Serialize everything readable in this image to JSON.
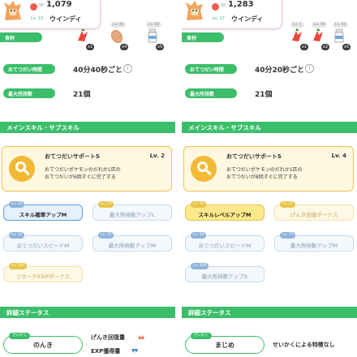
{
  "panels": [
    {
      "sp_label": "SP",
      "sp_value": "1,079",
      "level": "Lv. 13",
      "pokemon_name": "ウインディ",
      "ingredients_label": "食材",
      "ingredients": [
        {
          "level": "Lv. 1",
          "count": "x1"
        },
        {
          "level": "Lv. 30",
          "count": "x4"
        },
        {
          "level": "Lv. 60",
          "count": "x5"
        }
      ],
      "help_time_label": "おてつだい時間",
      "help_time_value": "40分40秒ごと",
      "max_carry_label": "最大所持数",
      "max_carry_value": "21個",
      "section_skills": "メインスキル・サブスキル",
      "main_skill": {
        "name": "おてつだいサポートS",
        "level": "Lv. 2",
        "description_line1": "おてつだいポケモンのだれか1匹の",
        "description_line2": "おてつだいが6回すぐに完了する"
      },
      "sub_skills": [
        {
          "level": "Lv. 10",
          "label": "スキル確率アップM"
        },
        {
          "level": "Lv. 25",
          "label": "最大所持数アップL"
        },
        {
          "level": "Lv. 50",
          "label": "おてつだいスピードM"
        },
        {
          "level": "Lv. 75",
          "label": "最大所持数アップM"
        },
        {
          "level": "Lv. 100",
          "label": "リサーチEXPボーナス"
        }
      ],
      "section_status": "詳細ステータス",
      "nature_tag": "せいかく",
      "nature_name": "のんき",
      "nature_up": "げんき回復量",
      "nature_down": "EXP獲得量",
      "nature_none": ""
    },
    {
      "sp_label": "SP",
      "sp_value": "1,283",
      "level": "Lv. 17",
      "pokemon_name": "ウインディ",
      "ingredients_label": "食材",
      "ingredients": [
        {
          "level": "Lv. 1",
          "count": "x1"
        },
        {
          "level": "Lv. 30",
          "count": "x2"
        },
        {
          "level": "Lv. 60",
          "count": "x5"
        }
      ],
      "help_time_label": "おてつだい時間",
      "help_time_value": "40分20秒ごと",
      "max_carry_label": "最大所持数",
      "max_carry_value": "21個",
      "section_skills": "メインスキル・サブスキル",
      "main_skill": {
        "name": "おてつだいサポートS",
        "level": "Lv. 4",
        "description_line1": "おてつだいポケモンのだれか1匹の",
        "description_line2": "おてつだいが8回すぐに完了する"
      },
      "sub_skills": [
        {
          "level": "Lv. 10",
          "label": "スキルレベルアップM"
        },
        {
          "level": "Lv. 25",
          "label": "げんき回復ボーナス"
        },
        {
          "level": "Lv. 50",
          "label": "おてつだいスピードM"
        },
        {
          "level": "Lv. 75",
          "label": "最大所持数アップM"
        },
        {
          "level": "Lv. 100",
          "label": "最大所持数アップS"
        }
      ],
      "section_status": "詳細ステータス",
      "nature_tag": "せいかく",
      "nature_name": "まじめ",
      "nature_up": "",
      "nature_down": "",
      "nature_none": "せいかくによる特徴なし"
    }
  ],
  "icons": {
    "info": "i",
    "up_arrows": "▲▲",
    "down_arrows": "▼▼"
  },
  "colors": {
    "green": "#3bbe6a",
    "gold": "#f0c34a",
    "blue": "#5a9be0",
    "sp_red": "#ef5c4e"
  }
}
